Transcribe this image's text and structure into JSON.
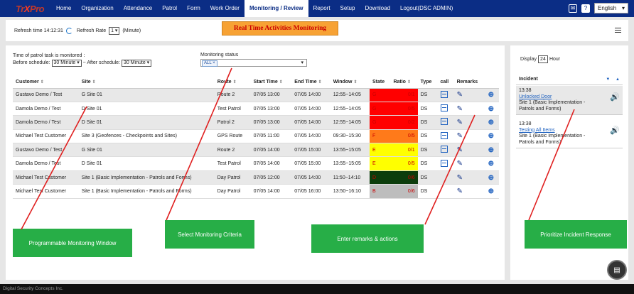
{
  "topnav": {
    "logo_a": "Tr",
    "logo_b": "X",
    "logo_c": "Pro",
    "items": [
      "Home",
      "Organization",
      "Attendance",
      "Patrol",
      "Form",
      "Work Order",
      "Monitoring / Review",
      "Report",
      "Setup",
      "Download",
      "Logout(DSC ADMIN)"
    ],
    "active_index": 6,
    "language": "English"
  },
  "bar2": {
    "refresh_time": "Refresh time 14:12:31",
    "refresh_rate_label": "Refresh Rate",
    "refresh_rate_value": "1",
    "refresh_rate_unit": "(Minute)",
    "title": "Real Time Activities Monitoring"
  },
  "filters": {
    "line1": "Time of patrol task is monitored :",
    "before_label": "Before schedule:",
    "before_value": "30 Minute",
    "after_label": "~ After schedule:",
    "after_value": "30 Minute",
    "status_label": "Monitoring status",
    "status_chip": "ALL ×"
  },
  "table": {
    "headers": [
      "Customer",
      "Site",
      "Route",
      "Start Time",
      "End Time",
      "Window",
      "State",
      "Ratio",
      "Type",
      "call",
      "Remarks",
      ""
    ],
    "rows": [
      {
        "customer": "Gustavo Demo / Test",
        "site": "G Site 01",
        "route": "Route 2",
        "start": "07/05 13:00",
        "end": "07/05 14:00",
        "window": "12:55~14:05",
        "state": "G",
        "ratio": "0/1",
        "type": "DS",
        "color": "#ff0000",
        "call": true
      },
      {
        "customer": "Damola Demo / Test",
        "site": "D Site 01",
        "route": "Test Patrol",
        "start": "07/05 13:00",
        "end": "07/05 14:00",
        "window": "12:55~14:05",
        "state": "G",
        "ratio": "0/5",
        "type": "DS",
        "color": "#ff0000",
        "call": true
      },
      {
        "customer": "Damola Demo / Test",
        "site": "D Site 01",
        "route": "Patrol 2",
        "start": "07/05 13:00",
        "end": "07/05 14:00",
        "window": "12:55~14:05",
        "state": "G",
        "ratio": "0/2",
        "type": "DS",
        "color": "#ff0000",
        "call": true
      },
      {
        "customer": "Michael Test Customer",
        "site": "Site 3 (Geofences - Checkpoints and Sites)",
        "route": "GPS Route",
        "start": "07/05 11:00",
        "end": "07/05 14:00",
        "window": "09:30~15:30",
        "state": "F",
        "ratio": "0/5",
        "type": "DS",
        "color": "#ff7a1a",
        "call": true
      },
      {
        "customer": "Gustavo Demo / Test",
        "site": "G Site 01",
        "route": "Route 2",
        "start": "07/05 14:00",
        "end": "07/05 15:00",
        "window": "13:55~15:05",
        "state": "E",
        "ratio": "0/1",
        "type": "DS",
        "color": "#ffff00",
        "call": true
      },
      {
        "customer": "Damola Demo / Test",
        "site": "D Site 01",
        "route": "Test Patrol",
        "start": "07/05 14:00",
        "end": "07/05 15:00",
        "window": "13:55~15:05",
        "state": "E",
        "ratio": "0/5",
        "type": "DS",
        "color": "#ffff00",
        "call": true
      },
      {
        "customer": "Michael Test Customer",
        "site": "Site 1 (Basic Implementation - Patrols and Forms)",
        "route": "Day Patrol",
        "start": "07/05 12:00",
        "end": "07/05 14:00",
        "window": "11:50~14:10",
        "state": "D",
        "ratio": "0/6",
        "type": "DS",
        "color": "#0c3d0c",
        "call": false
      },
      {
        "customer": "Michael Test Customer",
        "site": "Site 1 (Basic Implementation - Patrols and Forms)",
        "route": "Day Patrol",
        "start": "07/05 14:00",
        "end": "07/05 16:00",
        "window": "13:50~16:10",
        "state": "B",
        "ratio": "0/6",
        "type": "DS",
        "color": "#bdbdbd",
        "call": false
      }
    ]
  },
  "callouts": {
    "a": "Programmable Monitoring Window",
    "b": "Select Monitoring Criteria",
    "c": "Enter remarks & actions",
    "d": "Prioritize Incident Response"
  },
  "side": {
    "display_label": "Display",
    "display_value": "24",
    "display_unit": "Hour",
    "incident_header": "Incident",
    "incidents": [
      {
        "time": "13:38",
        "title": "Unlocked Door",
        "site": "Site 1 (Basic Implementation - Patrols and Forms)"
      },
      {
        "time": "13:38",
        "title": "Testing All Items",
        "site": "Site 1 (Basic Implementation - Patrols and Forms)"
      }
    ]
  },
  "footer": "Digital Security Concepts Inc."
}
